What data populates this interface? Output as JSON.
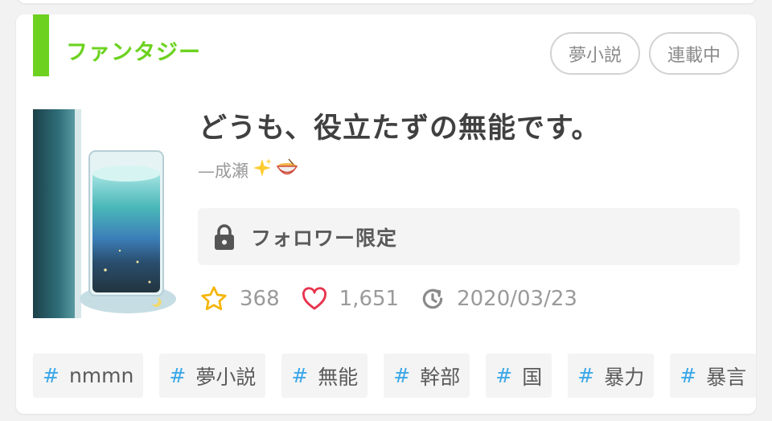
{
  "genre": "ファンタジー",
  "badges": [
    "夢小説",
    "連載中"
  ],
  "title": "どうも、役立たずの無能です。",
  "author": {
    "prefix": "— ",
    "name": "成瀬"
  },
  "lock_label": "フォロワー限定",
  "stats": {
    "stars": "368",
    "likes": "1,651",
    "updated": "2020/03/23"
  },
  "tags": [
    "nmmn",
    "夢小説",
    "無能",
    "幹部",
    "国",
    "暴力",
    "暴言"
  ],
  "tag_hash": "#",
  "colors": {
    "genre": "#6cd21f",
    "star": "#f5b400",
    "heart": "#e8344e",
    "hash": "#3aa7e8"
  },
  "icons": [
    "lock-icon",
    "star-icon",
    "heart-icon",
    "history-icon",
    "sparkles-emoji",
    "ramen-emoji"
  ]
}
